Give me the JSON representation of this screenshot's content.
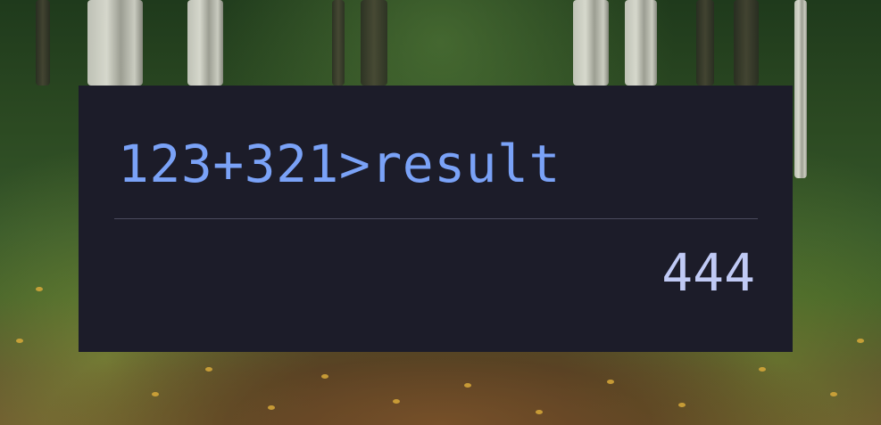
{
  "calculator": {
    "expression": "123+321>result",
    "result": "444"
  }
}
